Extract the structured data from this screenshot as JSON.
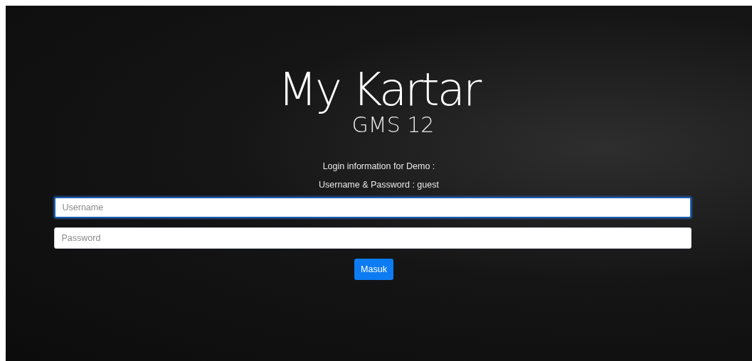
{
  "logo": {
    "title": "My Kartar",
    "subtitle": "GMS 12"
  },
  "info": [
    "Login information for Demo :",
    "Username & Password : guest"
  ],
  "fields": [
    {
      "placeholder": "Username",
      "focused": true
    },
    {
      "placeholder": "Password",
      "focused": false
    }
  ],
  "submit": "Masuk"
}
